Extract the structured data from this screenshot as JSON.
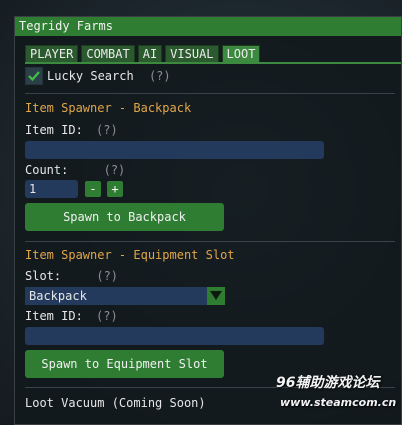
{
  "window": {
    "title": "Tegridy Farms"
  },
  "tabs": [
    "PLAYER",
    "COMBAT",
    "AI",
    "VISUAL",
    "LOOT"
  ],
  "active_tab": "LOOT",
  "lucky_search": {
    "label": "Lucky Search",
    "help": "(?)",
    "checked": true
  },
  "backpack_spawner": {
    "title": "Item Spawner - Backpack",
    "item_id_label": "Item ID:",
    "item_id_help": "(?)",
    "item_id_value": "",
    "count_label": "Count:",
    "count_help": "(?)",
    "count_value": "1",
    "minus": "-",
    "plus": "+",
    "spawn_button": "Spawn to Backpack"
  },
  "equipment_spawner": {
    "title": "Item Spawner - Equipment Slot",
    "slot_label": "Slot:",
    "slot_help": "(?)",
    "slot_value": "Backpack",
    "item_id_label": "Item ID:",
    "item_id_help": "(?)",
    "item_id_value": "",
    "spawn_button": "Spawn to Equipment Slot"
  },
  "loot_vacuum": {
    "label": "Loot Vacuum (Coming Soon)"
  },
  "watermark": {
    "line1": "96辅助游戏论坛",
    "line2": "www.steamcom.cn"
  },
  "colors": {
    "accent": "#2f7d33",
    "section_title": "#e0a64a",
    "input_bg": "#233a5c"
  }
}
